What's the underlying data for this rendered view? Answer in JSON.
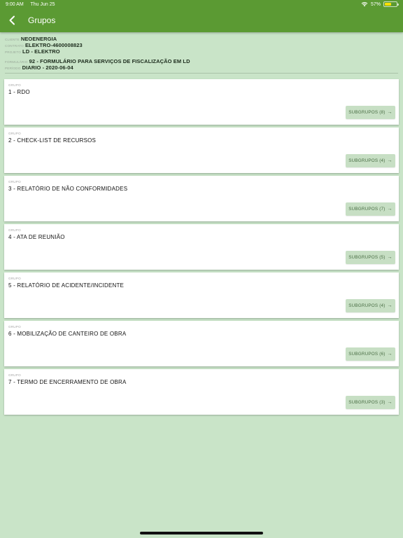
{
  "status_bar": {
    "time": "9:00 AM",
    "date": "Thu Jun 25",
    "battery": "57%",
    "battery_level": 0.57
  },
  "header": {
    "title": "Grupos",
    "back_icon": "chevron-left-icon",
    "color": "#5b9a33"
  },
  "info": {
    "client_label": "CLIENTE",
    "client_value": "NEOENERGIA",
    "contract_label": "CONTRATO",
    "contract_value": "ELEKTRO-4600008823",
    "project_label": "PROJETO",
    "project_value": "LD - ELEKTRO",
    "form_label": "FORMULÁRIO",
    "form_value": "92 - FORMULÁRIO PARA SERVIÇOS DE FISCALIZAÇÃO EM LD",
    "period_label": "PERÍODO",
    "period_value": "DIARIO - 2020-06-04"
  },
  "groups": [
    {
      "label": "GRUPO",
      "title": "1 - RDO",
      "button": "SUBGRUPOS (8)"
    },
    {
      "label": "GRUPO",
      "title": "2 - CHECK-LIST DE RECURSOS",
      "button": "SUBGRUPOS (4)"
    },
    {
      "label": "GRUPO",
      "title": "3 - RELATÓRIO DE NÃO CONFORMIDADES",
      "button": "SUBGRUPOS (7)"
    },
    {
      "label": "GRUPO",
      "title": "4 - ATA DE REUNIÃO",
      "button": "SUBGRUPOS (5)"
    },
    {
      "label": "GRUPO",
      "title": "5 - RELATÓRIO DE ACIDENTE/INCIDENTE",
      "button": "SUBGRUPOS (4)"
    },
    {
      "label": "GRUPO",
      "title": "6 - MOBILIZAÇÃO DE CANTEIRO DE OBRA",
      "button": "SUBGRUPOS (6)"
    },
    {
      "label": "GRUPO",
      "title": "7 - TERMO DE ENCERRAMENTO DE OBRA",
      "button": "SUBGRUPOS (3)"
    }
  ],
  "arrow_glyph": "→",
  "colors": {
    "background": "#c9e4c8",
    "button_bg": "#c7dfc4",
    "button_text": "#4a6e45"
  }
}
